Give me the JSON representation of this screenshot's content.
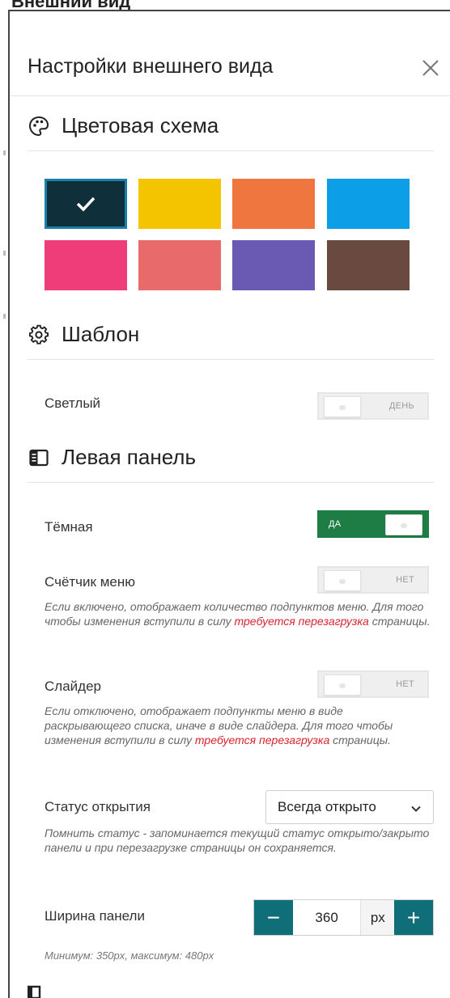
{
  "page_heading_partial": "Внешний вид",
  "panel": {
    "title": "Настройки внешнего вида",
    "close_icon": "close-icon"
  },
  "color_scheme": {
    "title": "Цветовая схема",
    "icon": "palette-icon",
    "swatches": [
      {
        "color": "#0f2f3a",
        "selected": true
      },
      {
        "color": "#f5c400",
        "selected": false
      },
      {
        "color": "#f07640",
        "selected": false
      },
      {
        "color": "#0c9ee6",
        "selected": false
      },
      {
        "color": "#ee3d79",
        "selected": false
      },
      {
        "color": "#e86a6a",
        "selected": false
      },
      {
        "color": "#6b5ab3",
        "selected": false
      },
      {
        "color": "#6a4a40",
        "selected": false
      }
    ]
  },
  "template": {
    "title": "Шаблон",
    "icon": "gear-icon",
    "light_label": "Светлый",
    "light_toggle": {
      "on": false,
      "state_label": "ДЕНЬ"
    }
  },
  "left_panel": {
    "title": "Левая панель",
    "icon": "sidebar-icon",
    "dark": {
      "label": "Тёмная",
      "on": true,
      "state_label": "ДА"
    },
    "menu_counter": {
      "label": "Счётчик меню",
      "on": false,
      "state_label": "НЕТ",
      "help_before": "Если включено, отображает количество подпунктов меню. Для того чтобы изменения вступили в силу ",
      "help_warning": "требуется перезагрузка",
      "help_after": " страницы."
    },
    "slider": {
      "label": "Слайдер",
      "on": false,
      "state_label": "НЕТ",
      "help_before": "Если отключено, отображает подпункты меню в виде раскрывающего списка, иначе в виде слайдера. Для того чтобы изменения вступили в силу ",
      "help_warning": "требуется перезагрузка",
      "help_after": " страницы."
    },
    "open_status": {
      "label": "Статус открытия",
      "selected": "Всегда открыто",
      "help": "Помнить статус - запоминается текущий статус открыто/закрыто панели и при перезагрузке страницы он сохраняется."
    },
    "width": {
      "label": "Ширина панели",
      "value": "360",
      "unit": "px",
      "minus": "−",
      "plus": "+",
      "hint": "Минимум: 350px, максимум: 480px"
    }
  },
  "colors": {
    "accent_teal": "#0f6e78",
    "toggle_on": "#1e7d45",
    "warning_red": "#d9232e"
  }
}
